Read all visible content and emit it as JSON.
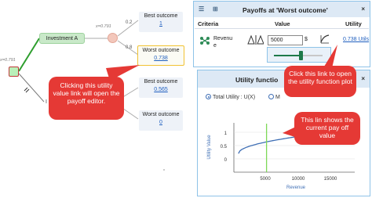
{
  "tree": {
    "investment_a_label": "Investment A",
    "ev_top": "x=0.791",
    "ev_root": "x=0.791",
    "prob_best_top": "0.2",
    "prob_worst_top": "0.8",
    "branch_b_letter": "I",
    "outcomes": [
      {
        "label": "Best outcome",
        "value": "1"
      },
      {
        "label": "Worst outcome",
        "value": "0.738"
      },
      {
        "label": "Best outcome",
        "value": "0.565"
      },
      {
        "label": "Worst outcome",
        "value": "0"
      }
    ]
  },
  "callouts": {
    "payoff_editor": "Clicking this utility value link will open the payoff editor.",
    "open_plot": "Click this link to open the utility function plot",
    "current_payoff": "This lin shows the current pay off value"
  },
  "payoffs_panel": {
    "title": "Payoffs at 'Worst outcome'",
    "close": "×",
    "col_criteria": "Criteria",
    "col_value": "Value",
    "col_utility": "Utility",
    "criterion_line1": "Revenu",
    "criterion_line2": "e",
    "value": "5000",
    "currency": "$",
    "utility": "0.738 Utils",
    "slider_fraction": 0.55
  },
  "utility_panel": {
    "title": "Utility functio",
    "close": "×",
    "radio_total": "Total Utility : U(X)",
    "radio_other": "M",
    "y_label": "Utility Value",
    "x_label": "Revenue",
    "y_ticks": [
      "1",
      "0.5",
      "0"
    ],
    "x_ticks": [
      "5000",
      "10000",
      "15000"
    ],
    "marker_x": 5000
  },
  "colors": {
    "accent_blue": "#1f5fbf",
    "callout_red": "#e53935",
    "curve": "#3f6fb5",
    "marker": "#7ed957",
    "selected_outline": "#f1c232"
  },
  "icons": {
    "panel_list": "list-icon",
    "panel_add": "add-icon",
    "criterion": "shuffle-icon",
    "scale": "scale-icon",
    "plot_link": "plot-icon"
  }
}
